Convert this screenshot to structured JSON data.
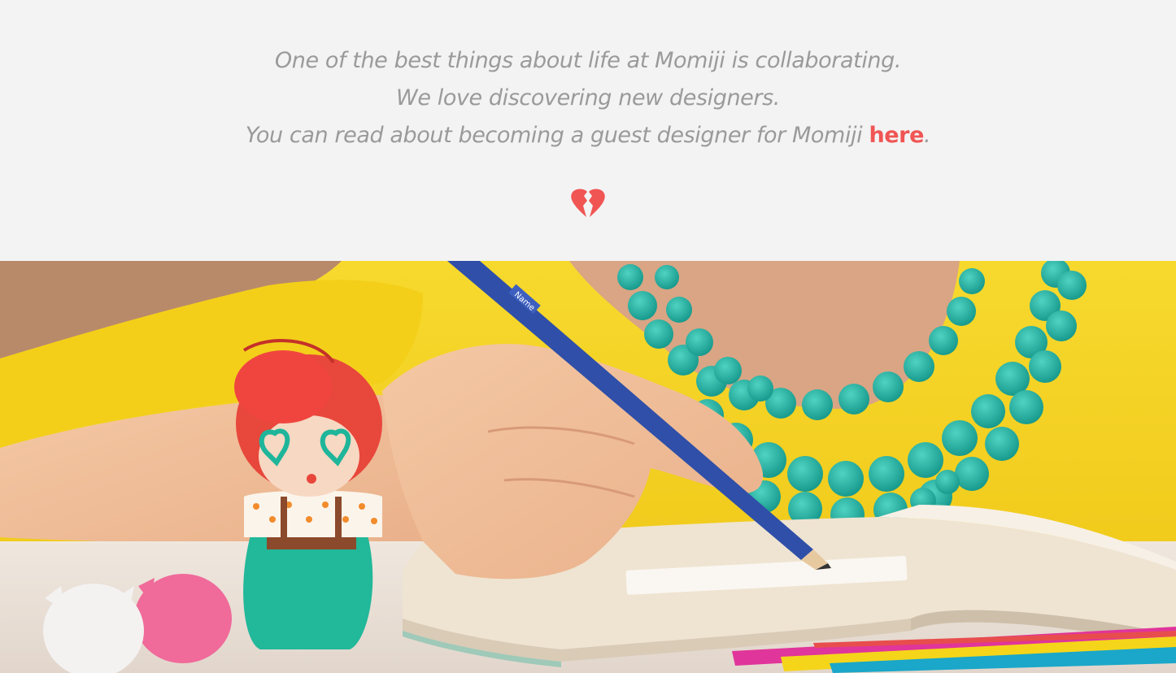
{
  "intro": {
    "line1": "One of the best things about life at Momiji is collaborating.",
    "line2": "We love discovering new designers.",
    "line3_prefix": "You can read about becoming a guest designer for Momiji ",
    "line3_link": "here",
    "line3_suffix": ".",
    "icon": "broken-heart-icon"
  },
  "hero": {
    "pencil_imprint": "Name",
    "description_icons": [
      "doll-figure",
      "pencil",
      "notebook",
      "beaded-necklace",
      "colored-pencils"
    ]
  },
  "colors": {
    "background": "#f3f3f3",
    "text": "#9a9a9a",
    "accent": "#f05554",
    "shirt": "#f4d21c",
    "necklace": "#1fb3a3"
  }
}
